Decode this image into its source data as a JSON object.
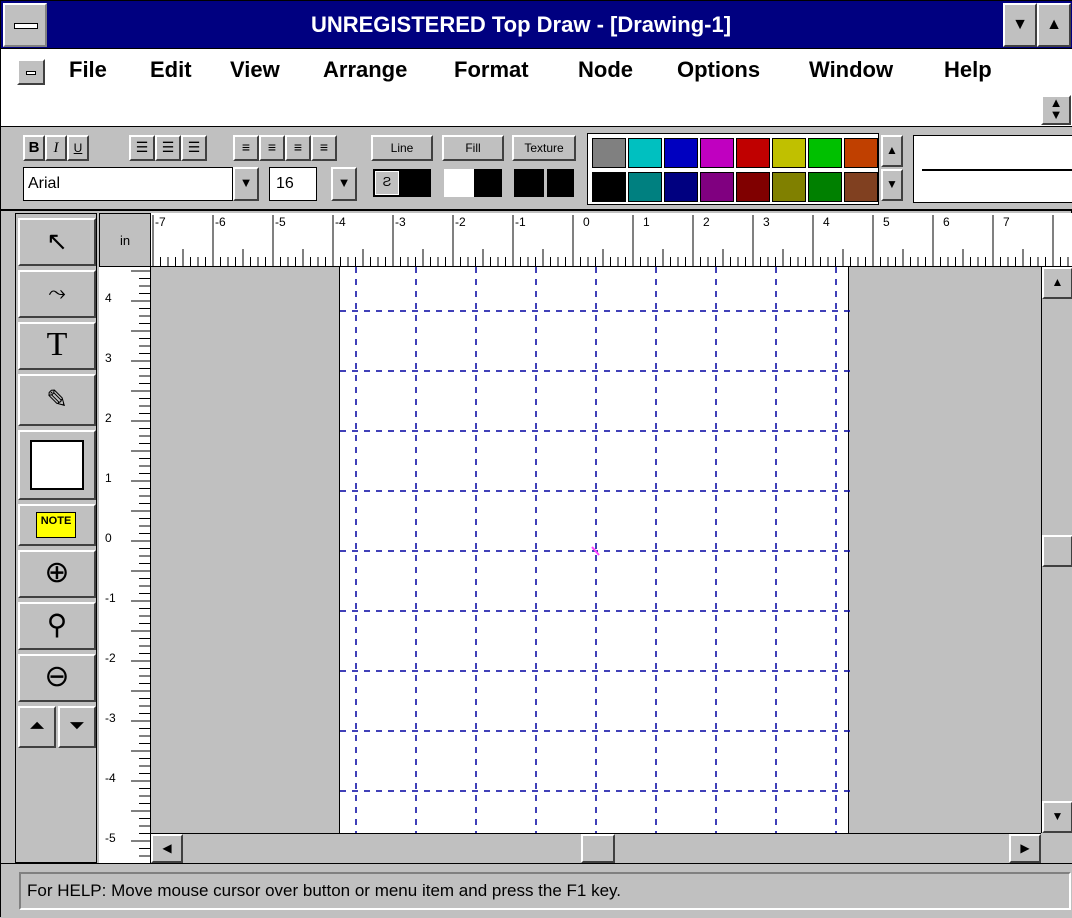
{
  "window": {
    "title": "UNREGISTERED Top Draw - [Drawing-1]",
    "minimize_glyph": "▼",
    "maximize_glyph": "▲"
  },
  "menu": {
    "items": [
      "File",
      "Edit",
      "View",
      "Arrange",
      "Format",
      "Node",
      "Options",
      "Window",
      "Help"
    ]
  },
  "toolbar": {
    "bold_label": "B",
    "italic_label": "I",
    "underline_label": "U",
    "line_label": "Line",
    "fill_label": "Fill",
    "texture_label": "Texture",
    "font_name": "Arial",
    "font_size": "16",
    "palette_top": [
      "#808080",
      "#00c0c0",
      "#0000c0",
      "#c000c0",
      "#c00000",
      "#c0c000",
      "#00c000",
      "#c04000"
    ],
    "palette_bottom": [
      "#000000",
      "#008080",
      "#000080",
      "#800080",
      "#800000",
      "#808000",
      "#008000",
      "#804020"
    ]
  },
  "tools": {
    "note_label": "NOTE"
  },
  "rulers": {
    "unit": "in",
    "h_labels": [
      "-7",
      "-6",
      "-5",
      "-4",
      "-3",
      "-2",
      "-1",
      "0",
      "1",
      "2",
      "3",
      "4",
      "5",
      "6",
      "7"
    ],
    "v_labels": [
      "4",
      "3",
      "2",
      "1",
      "0",
      "-1",
      "-2",
      "-3",
      "-4",
      "-5"
    ]
  },
  "status": {
    "text": "For HELP: Move mouse cursor over button or menu item and press the F1 key."
  }
}
